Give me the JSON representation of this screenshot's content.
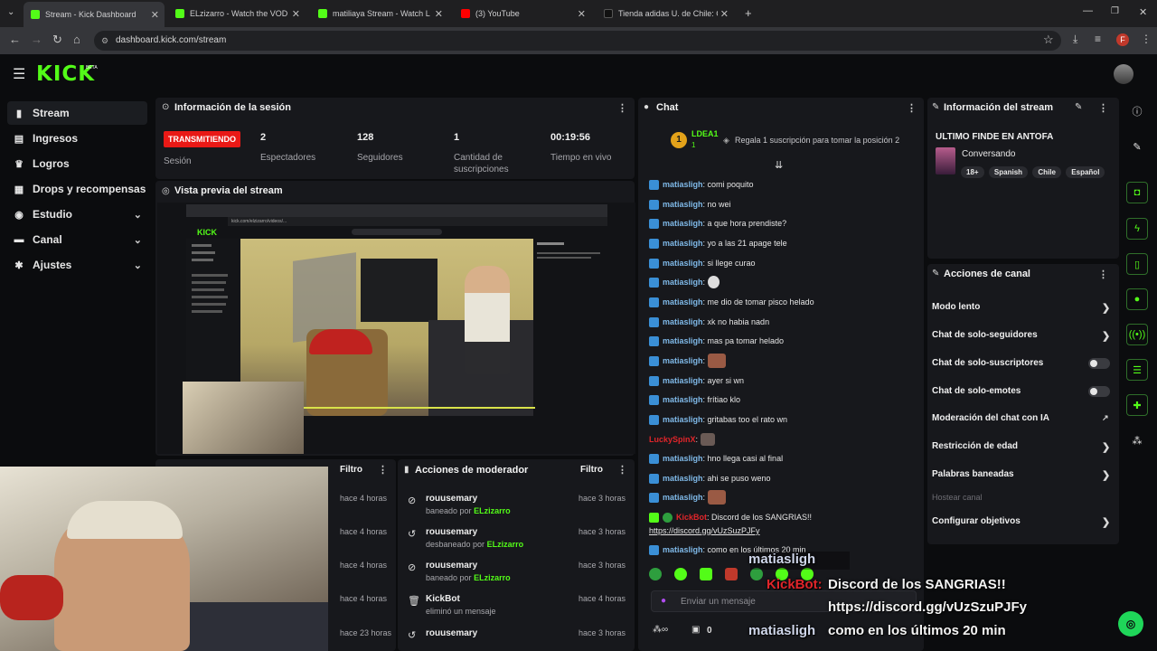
{
  "browser": {
    "tabs": [
      {
        "label": "Stream - Kick Dashboard",
        "active": true
      },
      {
        "label": "ELzizarro - Watch the VOD on Kick",
        "active": false
      },
      {
        "label": "matiliaya Stream - Watch Live on Kick",
        "active": false
      },
      {
        "label": "(3) YouTube",
        "active": false
      },
      {
        "label": "Tienda adidas U. de Chile: Camisetas",
        "active": false
      }
    ],
    "url": "dashboard.kick.com/stream",
    "profile_initial": "F"
  },
  "brand": {
    "logo": "KICK",
    "beta": "BETA",
    "accent": "#53fc18"
  },
  "sidebar": {
    "items": [
      {
        "label": "Stream",
        "icon": "stream-icon",
        "selected": true
      },
      {
        "label": "Ingresos",
        "icon": "ingresos-icon"
      },
      {
        "label": "Logros",
        "icon": "trophy-icon"
      },
      {
        "label": "Drops y recompensas",
        "icon": "gift-icon"
      },
      {
        "label": "Estudio",
        "icon": "studio-icon",
        "expandable": true
      },
      {
        "label": "Canal",
        "icon": "canal-icon",
        "expandable": true
      },
      {
        "label": "Ajustes",
        "icon": "gear-icon",
        "expandable": true
      }
    ]
  },
  "session": {
    "title": "Información de la sesión",
    "status": "TRANSMITIENDO",
    "status_label": "Sesión",
    "viewers": "2",
    "viewers_label": "Espectadores",
    "followers": "128",
    "followers_label": "Seguidores",
    "subs": "1",
    "subs_label": "Cantidad de suscripciones",
    "live_time": "00:19:56",
    "live_time_label": "Tiempo en vivo"
  },
  "preview": {
    "title": "Vista previa del stream",
    "inner_url": "kick.com/elzizarro/videos/...",
    "inner_logo": "KICK"
  },
  "bans": {
    "filter": "Filtro",
    "times": [
      "hace 4 horas",
      "hace 4 horas",
      "hace 4 horas",
      "hace 4 horas",
      "hace 23 horas"
    ]
  },
  "mod_actions": {
    "title": "Acciones de moderador",
    "filter": "Filtro",
    "rows": [
      {
        "user": "rouusemary",
        "action": "baneado por",
        "by": "ELzizarro",
        "time": "hace 3 horas",
        "icon": "ban-icon"
      },
      {
        "user": "rouusemary",
        "action": "desbaneado por",
        "by": "ELzizarro",
        "time": "hace 3 horas",
        "icon": "unban-icon"
      },
      {
        "user": "rouusemary",
        "action": "baneado por",
        "by": "ELzizarro",
        "time": "hace 3 horas",
        "icon": "ban-icon"
      },
      {
        "user": "KickBot",
        "action": "eliminó un mensaje",
        "by": "",
        "time": "hace 4 horas",
        "icon": "trash-icon"
      },
      {
        "user": "rouusemary",
        "action": "",
        "by": "",
        "time": "hace 3 horas",
        "icon": "unban-icon"
      }
    ]
  },
  "chat": {
    "title": "Chat",
    "leader_rank": "1",
    "leader_name": "LDEA1",
    "leader_count": "1",
    "gift_text": "Regala 1 suscripción para tomar la posición 2",
    "messages": [
      {
        "user": "matiasligh",
        "text": ": comi poquito"
      },
      {
        "user": "matiasligh",
        "text": ": no wei"
      },
      {
        "user": "matiasligh",
        "text": ": a que hora prendiste?"
      },
      {
        "user": "matiasligh",
        "text": ": yo a las 21 apage tele"
      },
      {
        "user": "matiasligh",
        "text": ": si llege curao"
      },
      {
        "user": "matiasligh",
        "text": ":",
        "emote": true
      },
      {
        "user": "matiasligh",
        "text": ": me dio de tomar pisco helado"
      },
      {
        "user": "matiasligh",
        "text": ": xk no habia nadn"
      },
      {
        "user": "matiasligh",
        "text": ": mas pa tomar helado"
      },
      {
        "user": "matiasligh",
        "text": ":",
        "emote": true
      },
      {
        "user": "matiasligh",
        "text": ": ayer si wn"
      },
      {
        "user": "matiasligh",
        "text": ": frítiao klo"
      },
      {
        "user": "matiasligh",
        "text": ": gritabas too el rato wn"
      },
      {
        "user": "LuckySpinX",
        "text": ":",
        "emote": true,
        "red": true
      },
      {
        "user": "matiasligh",
        "text": ": hno llega casi al final"
      },
      {
        "user": "matiasligh",
        "text": ": ahi se puso weno"
      },
      {
        "user": "matiasligh",
        "text": ":",
        "emote": true
      }
    ],
    "bot_user": "KickBot",
    "bot_text": ": Discord de los SANGRIAS!!",
    "bot_link": "https://discord.gg/vUzSuzPJFy",
    "last_user": "matiasligh",
    "last_text": ": como en los últimos 20 min",
    "input_placeholder": "Enviar un mensaje",
    "points": "0"
  },
  "stream_info": {
    "title": "Información del stream",
    "stream_title": "ULTIMO FINDE EN ANTOFA",
    "category": "Conversando",
    "tags": [
      "18+",
      "Spanish",
      "Chile",
      "Español"
    ]
  },
  "channel_actions": {
    "title": "Acciones de canal",
    "rows": [
      {
        "label": "Modo lento",
        "control": "chevron"
      },
      {
        "label": "Chat de solo-seguidores",
        "control": "chevron"
      },
      {
        "label": "Chat de solo-suscriptores",
        "control": "toggle"
      },
      {
        "label": "Chat de solo-emotes",
        "control": "toggle"
      },
      {
        "label": "Moderación del chat con IA",
        "control": "external"
      },
      {
        "label": "Restricción de edad",
        "control": "chevron"
      },
      {
        "label": "Palabras baneadas",
        "control": "chevron"
      },
      {
        "label": "Hostear canal",
        "control": "disabled"
      },
      {
        "label": "Configurar objetivos",
        "control": "chevron"
      }
    ]
  },
  "overlay": {
    "user1": "matiasligh",
    "bot": "KickBot:",
    "line1": "Discord de los SANGRIAS!!",
    "link": "https://discord.gg/vUzSzuPJFy",
    "user2": "matiasligh",
    "line2": "como en los últimos 20 min"
  }
}
